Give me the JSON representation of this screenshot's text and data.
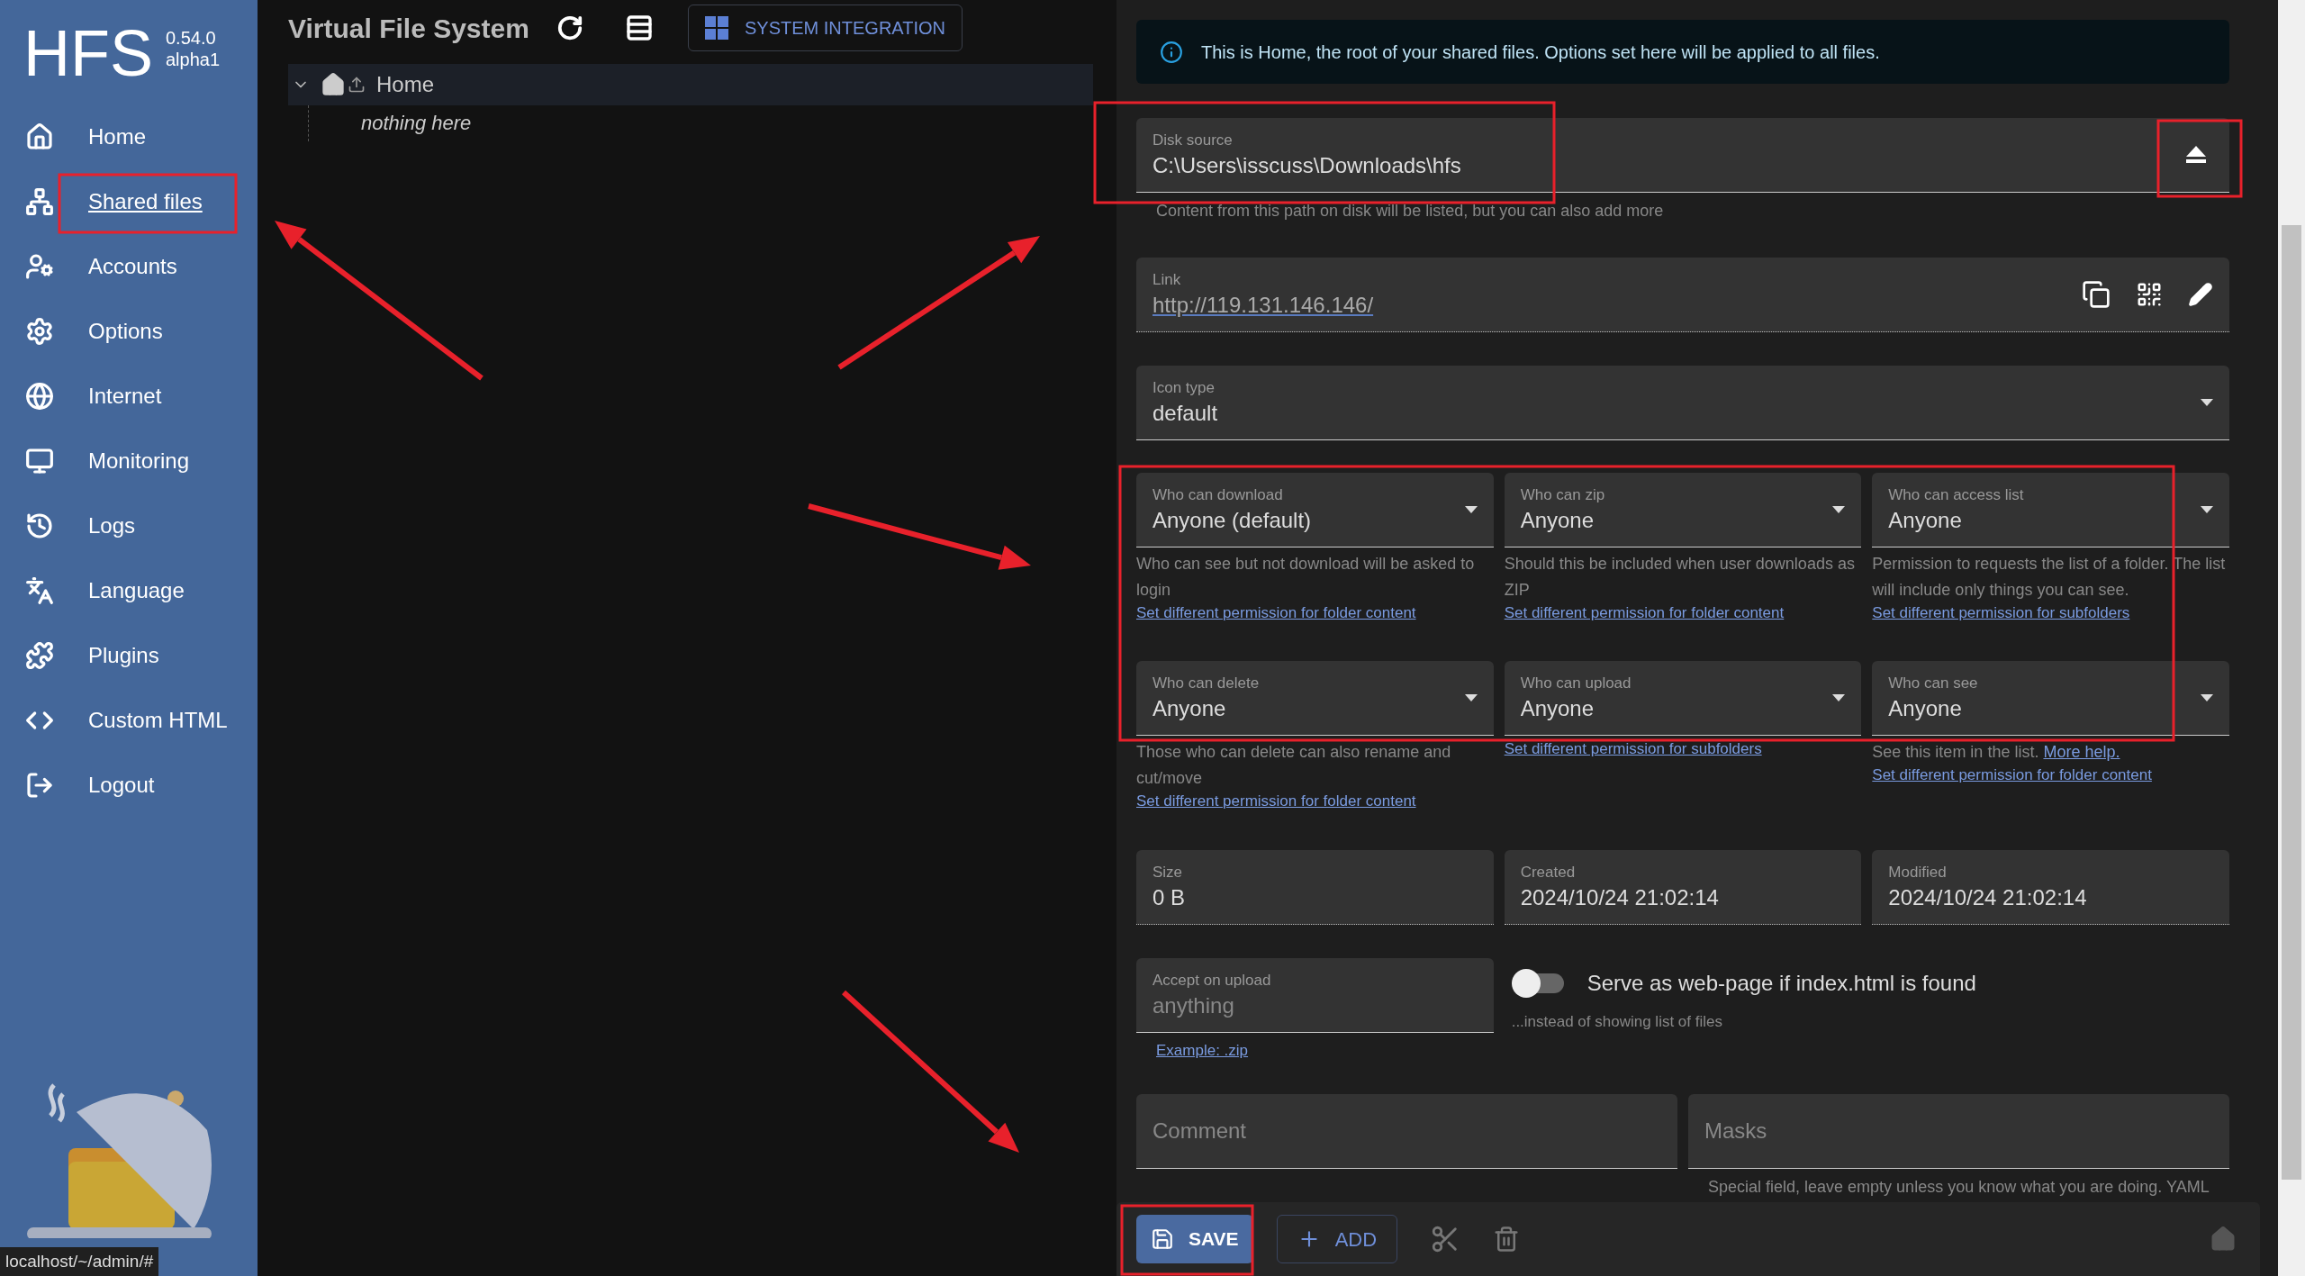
{
  "app": {
    "name": "HFS",
    "version": "0.54.0",
    "channel": "alpha1"
  },
  "nav": [
    {
      "label": "Home",
      "selected": false
    },
    {
      "label": "Shared files",
      "selected": true
    },
    {
      "label": "Accounts",
      "selected": false
    },
    {
      "label": "Options",
      "selected": false
    },
    {
      "label": "Internet",
      "selected": false
    },
    {
      "label": "Monitoring",
      "selected": false
    },
    {
      "label": "Logs",
      "selected": false
    },
    {
      "label": "Language",
      "selected": false
    },
    {
      "label": "Plugins",
      "selected": false
    },
    {
      "label": "Custom HTML",
      "selected": false
    },
    {
      "label": "Logout",
      "selected": false
    }
  ],
  "status_url": "localhost/~/admin/#",
  "vfs": {
    "title": "Virtual File System",
    "integration_button": "SYSTEM INTEGRATION",
    "tree": [
      {
        "label": "Home",
        "expanded": true,
        "empty_text": "nothing here"
      }
    ]
  },
  "info": "This is Home, the root of your shared files. Options set here will be applied to all files.",
  "disk_source": {
    "label": "Disk source",
    "value": "C:\\Users\\isscuss\\Downloads\\hfs",
    "helper": "Content from this path on disk will be listed, but you can also add more"
  },
  "link": {
    "label": "Link",
    "value": "http://119.131.146.146/"
  },
  "icon_type": {
    "label": "Icon type",
    "value": "default"
  },
  "permissions": [
    {
      "label": "Who can download",
      "value": "Anyone (default)",
      "helper": "Who can see but not download will be asked to login",
      "link": "Set different permission for folder content"
    },
    {
      "label": "Who can zip",
      "value": "Anyone",
      "helper": "Should this be included when user downloads as ZIP",
      "link": "Set different permission for folder content"
    },
    {
      "label": "Who can access list",
      "value": "Anyone",
      "helper": "Permission to requests the list of a folder. The list will include only things you can see.",
      "link": "Set different permission for subfolders"
    },
    {
      "label": "Who can delete",
      "value": "Anyone",
      "helper": "Those who can delete can also rename and cut/move",
      "link": "Set different permission for folder content"
    },
    {
      "label": "Who can upload",
      "value": "Anyone",
      "link": "Set different permission for subfolders"
    },
    {
      "label": "Who can see",
      "value": "Anyone",
      "helper": "See this item in the list.",
      "helper_link": "More help.",
      "link": "Set different permission for folder content"
    }
  ],
  "details": [
    {
      "label": "Size",
      "value": "0 B"
    },
    {
      "label": "Created",
      "value": "2024/10/24 21:02:14"
    },
    {
      "label": "Modified",
      "value": "2024/10/24 21:02:14"
    }
  ],
  "accept": {
    "label": "Accept on upload",
    "placeholder": "anything",
    "link": "Example: .zip"
  },
  "serve_toggle": {
    "label": "Serve as web-page if index.html is found",
    "on": false,
    "helper": "...instead of showing list of files"
  },
  "comment": {
    "placeholder": "Comment"
  },
  "masks": {
    "placeholder": "Masks",
    "helper": "Special field, leave empty unless you know what you are doing. YAML"
  },
  "actions": {
    "save": "SAVE",
    "add": "ADD"
  }
}
